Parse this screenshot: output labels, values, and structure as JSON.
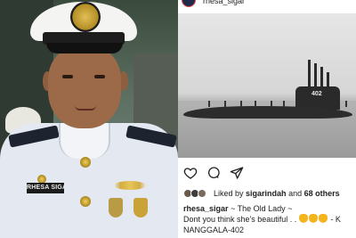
{
  "post": {
    "username": "rhesa_sigar",
    "liked_by_prefix": "Liked by",
    "liked_by_user": "sigarindah",
    "liked_by_and": "and",
    "liked_by_others": "68 others",
    "caption_username": "rhesa_sigar",
    "caption_line1": "~ The Old Lady ~",
    "caption_line2": "Dont you think she's beautiful . .",
    "caption_line2_suffix": "- K",
    "caption_line3": "NANGGALA-402",
    "caption_emoji_count": 3
  },
  "photo": {
    "submarine_number": "402"
  },
  "portrait": {
    "nametag": "RHESA SIGAR"
  },
  "icons": [
    "heart-icon",
    "comment-icon",
    "share-icon"
  ],
  "colors": {
    "text": "#222222",
    "avatar_ring": "#dd4444",
    "uniform": "#e4e9f1"
  }
}
